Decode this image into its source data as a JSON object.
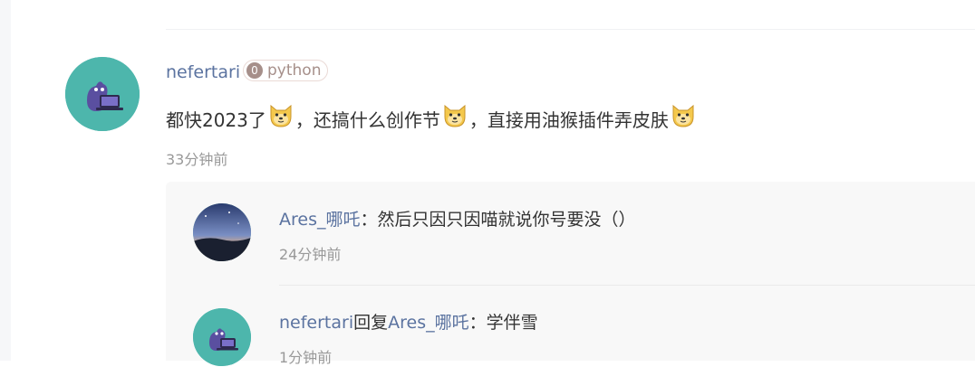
{
  "comment": {
    "author": "nefertari",
    "level_badge": {
      "level": "0",
      "tag": "python"
    },
    "content_parts": [
      "都快2023了",
      "，还搞什么创作节",
      "，直接用油猴插件弄皮肤"
    ],
    "emoji": "doge-emoji",
    "time": "33分钟前"
  },
  "replies": [
    {
      "author": "Ares_哪吒",
      "separator": "：",
      "text": "然后只因只因喵就说你号要没（）",
      "time": "24分钟前"
    },
    {
      "author": "nefertari",
      "reply_word": "回复",
      "target": "Ares_哪吒",
      "separator": "：",
      "text": "学伴雪",
      "time": "1分钟前"
    }
  ],
  "colors": {
    "link": "#5b73a0",
    "avatar_bg": "#4db6ac",
    "badge": "#a68f8a",
    "time": "#999999"
  }
}
